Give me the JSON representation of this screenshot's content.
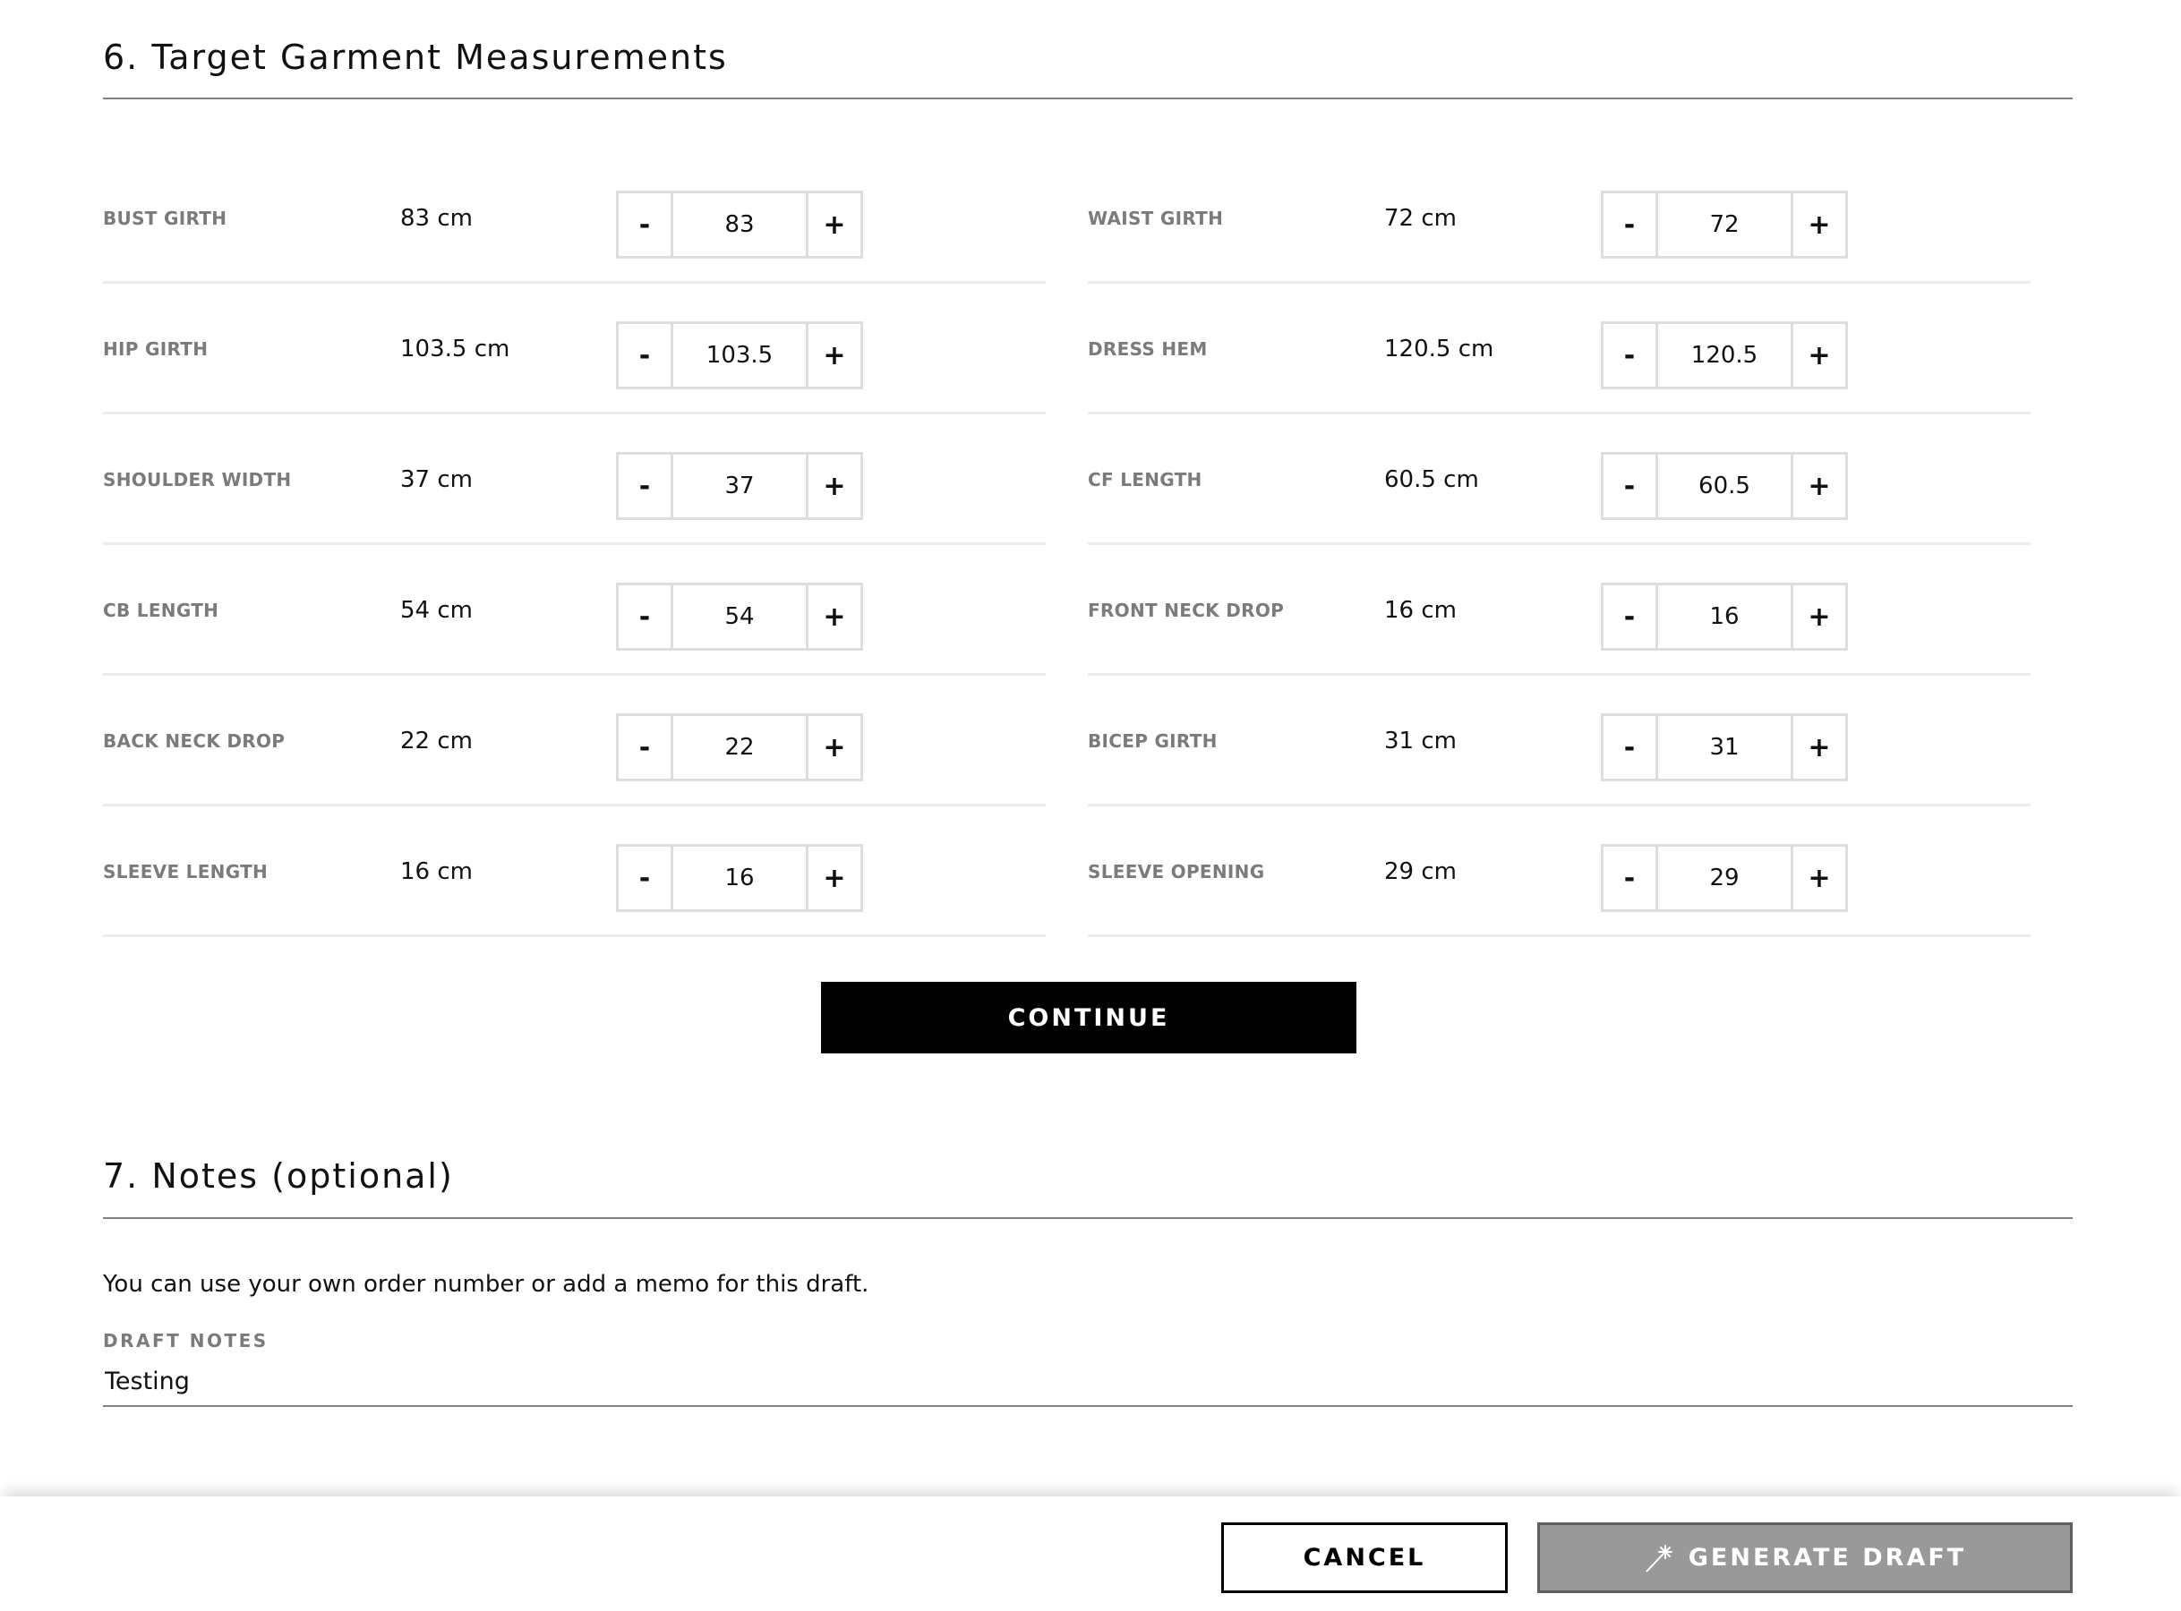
{
  "measurements_section": {
    "title": "6. Target Garment Measurements",
    "rows": [
      {
        "left": {
          "label": "BUST GIRTH",
          "display": "83 cm",
          "value": "83"
        },
        "right": {
          "label": "WAIST GIRTH",
          "display": "72 cm",
          "value": "72"
        }
      },
      {
        "left": {
          "label": "HIP GIRTH",
          "display": "103.5 cm",
          "value": "103.5"
        },
        "right": {
          "label": "DRESS HEM",
          "display": "120.5 cm",
          "value": "120.5"
        }
      },
      {
        "left": {
          "label": "SHOULDER WIDTH",
          "display": "37 cm",
          "value": "37"
        },
        "right": {
          "label": "CF LENGTH",
          "display": "60.5 cm",
          "value": "60.5"
        }
      },
      {
        "left": {
          "label": "CB LENGTH",
          "display": "54 cm",
          "value": "54"
        },
        "right": {
          "label": "FRONT NECK DROP",
          "display": "16 cm",
          "value": "16"
        }
      },
      {
        "left": {
          "label": "BACK NECK DROP",
          "display": "22 cm",
          "value": "22"
        },
        "right": {
          "label": "BICEP GIRTH",
          "display": "31 cm",
          "value": "31"
        }
      },
      {
        "left": {
          "label": "SLEEVE LENGTH",
          "display": "16 cm",
          "value": "16"
        },
        "right": {
          "label": "SLEEVE OPENING",
          "display": "29 cm",
          "value": "29"
        }
      }
    ],
    "stepper": {
      "decrement_label": "-",
      "increment_label": "+"
    },
    "continue_label": "CONTINUE"
  },
  "notes_section": {
    "title": "7. Notes (optional)",
    "description": "You can use your own order number or add a memo for this draft.",
    "field_label": "DRAFT NOTES",
    "field_value": "Testing"
  },
  "footer": {
    "cancel_label": "CANCEL",
    "generate_label": "GENERATE DRAFT",
    "generate_icon": "magic-wand-icon",
    "generate_state": "disabled"
  },
  "colors": {
    "primary": "#000000",
    "label_gray": "#7b7b7b",
    "disabled_button": "#999999"
  }
}
